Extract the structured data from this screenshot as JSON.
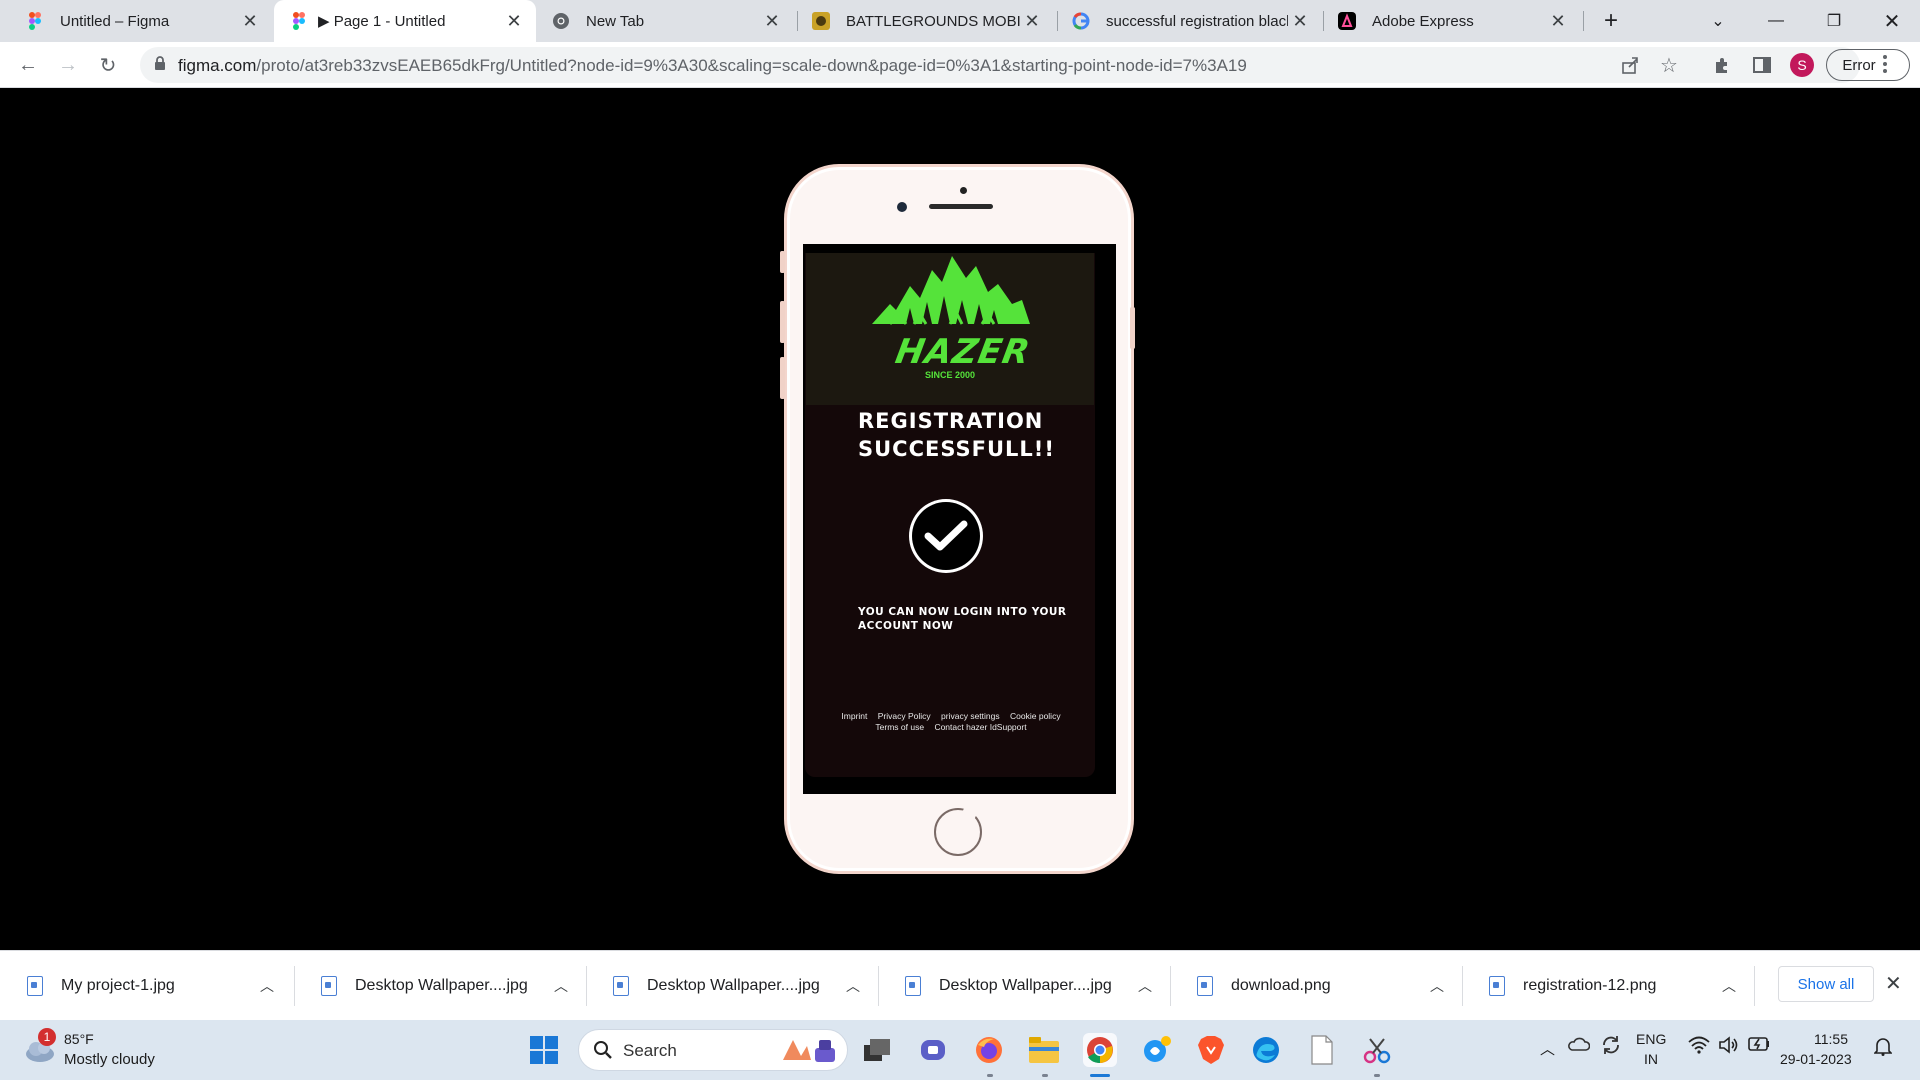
{
  "browser": {
    "tabs": [
      {
        "title": "Untitled – Figma",
        "favicon": "figma-icon",
        "active": false
      },
      {
        "title": "▶ Page 1 - Untitled",
        "favicon": "figma-icon",
        "active": true
      },
      {
        "title": "New Tab",
        "favicon": "chrome-icon",
        "active": false
      },
      {
        "title": "BATTLEGROUNDS MOBILE I",
        "favicon": "game-icon",
        "active": false
      },
      {
        "title": "successful registration blacl",
        "favicon": "google-icon",
        "active": false
      },
      {
        "title": "Adobe Express",
        "favicon": "adobe-express-icon",
        "active": false
      }
    ],
    "new_tab_label": "+",
    "url_main": "figma.com",
    "url_rest": "/proto/at3reb33zvsEAEB65dkFrg/Untitled?node-id=9%3A30&scaling=scale-down&page-id=0%3A1&starting-point-node-id=7%3A19",
    "profile_initial": "S",
    "error_label": "Error"
  },
  "app": {
    "brand": "HAZER",
    "tagline": "SINCE 2000",
    "headline_line1": "REGISTRATION",
    "headline_line2": "SUCCESSFULL!!",
    "message": "YOU CAN NOW LOGIN INTO YOUR ACCOUNT NOW",
    "footer_links_row1": [
      "Imprint",
      "Privacy Policy",
      "privacy settings",
      "Cookie policy"
    ],
    "footer_links_row2": [
      "Terms of use",
      "Contact hazer IdSupport"
    ],
    "accent_color": "#55e33a"
  },
  "downloads": {
    "items": [
      "My project-1.jpg",
      "Desktop Wallpaper....jpg",
      "Desktop Wallpaper....jpg",
      "Desktop Wallpaper....jpg",
      "download.png",
      "registration-12.png"
    ],
    "show_all": "Show all"
  },
  "taskbar": {
    "weather_badge": "1",
    "temperature": "85°F",
    "condition": "Mostly cloudy",
    "search_label": "Search",
    "lang_line1": "ENG",
    "lang_line2": "IN",
    "time": "11:55",
    "date": "29-01-2023"
  }
}
